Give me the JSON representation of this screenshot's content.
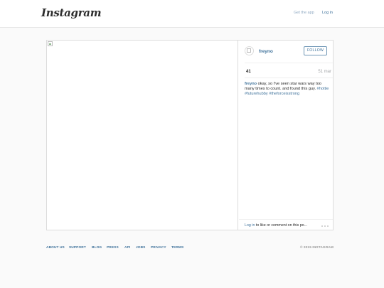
{
  "header": {
    "logo_text": "Instagram",
    "get_app_label": "Get the app",
    "login_label": "Log in"
  },
  "post": {
    "username": "freyno",
    "follow_label": "FOLLOW",
    "likes": "41",
    "date": "51 mar",
    "caption": {
      "username": "freyno",
      "text": " okay, so I've seen star wars way too many times to count. and found this guy. ",
      "tags": [
        "#hottie",
        "#futurehubby",
        "#theforceisstrong"
      ]
    },
    "login_prompt": {
      "link": "Log in",
      "text": " to like or comment on this po..."
    },
    "more_icon": "ellipsis-icon"
  },
  "footer": {
    "links": [
      "ABOUT US",
      "SUPPORT",
      "BLOG",
      "PRESS",
      "API",
      "JOBS",
      "PRIVACY",
      "TERMS"
    ],
    "copyright": "© 2015 INSTAGRAM"
  }
}
